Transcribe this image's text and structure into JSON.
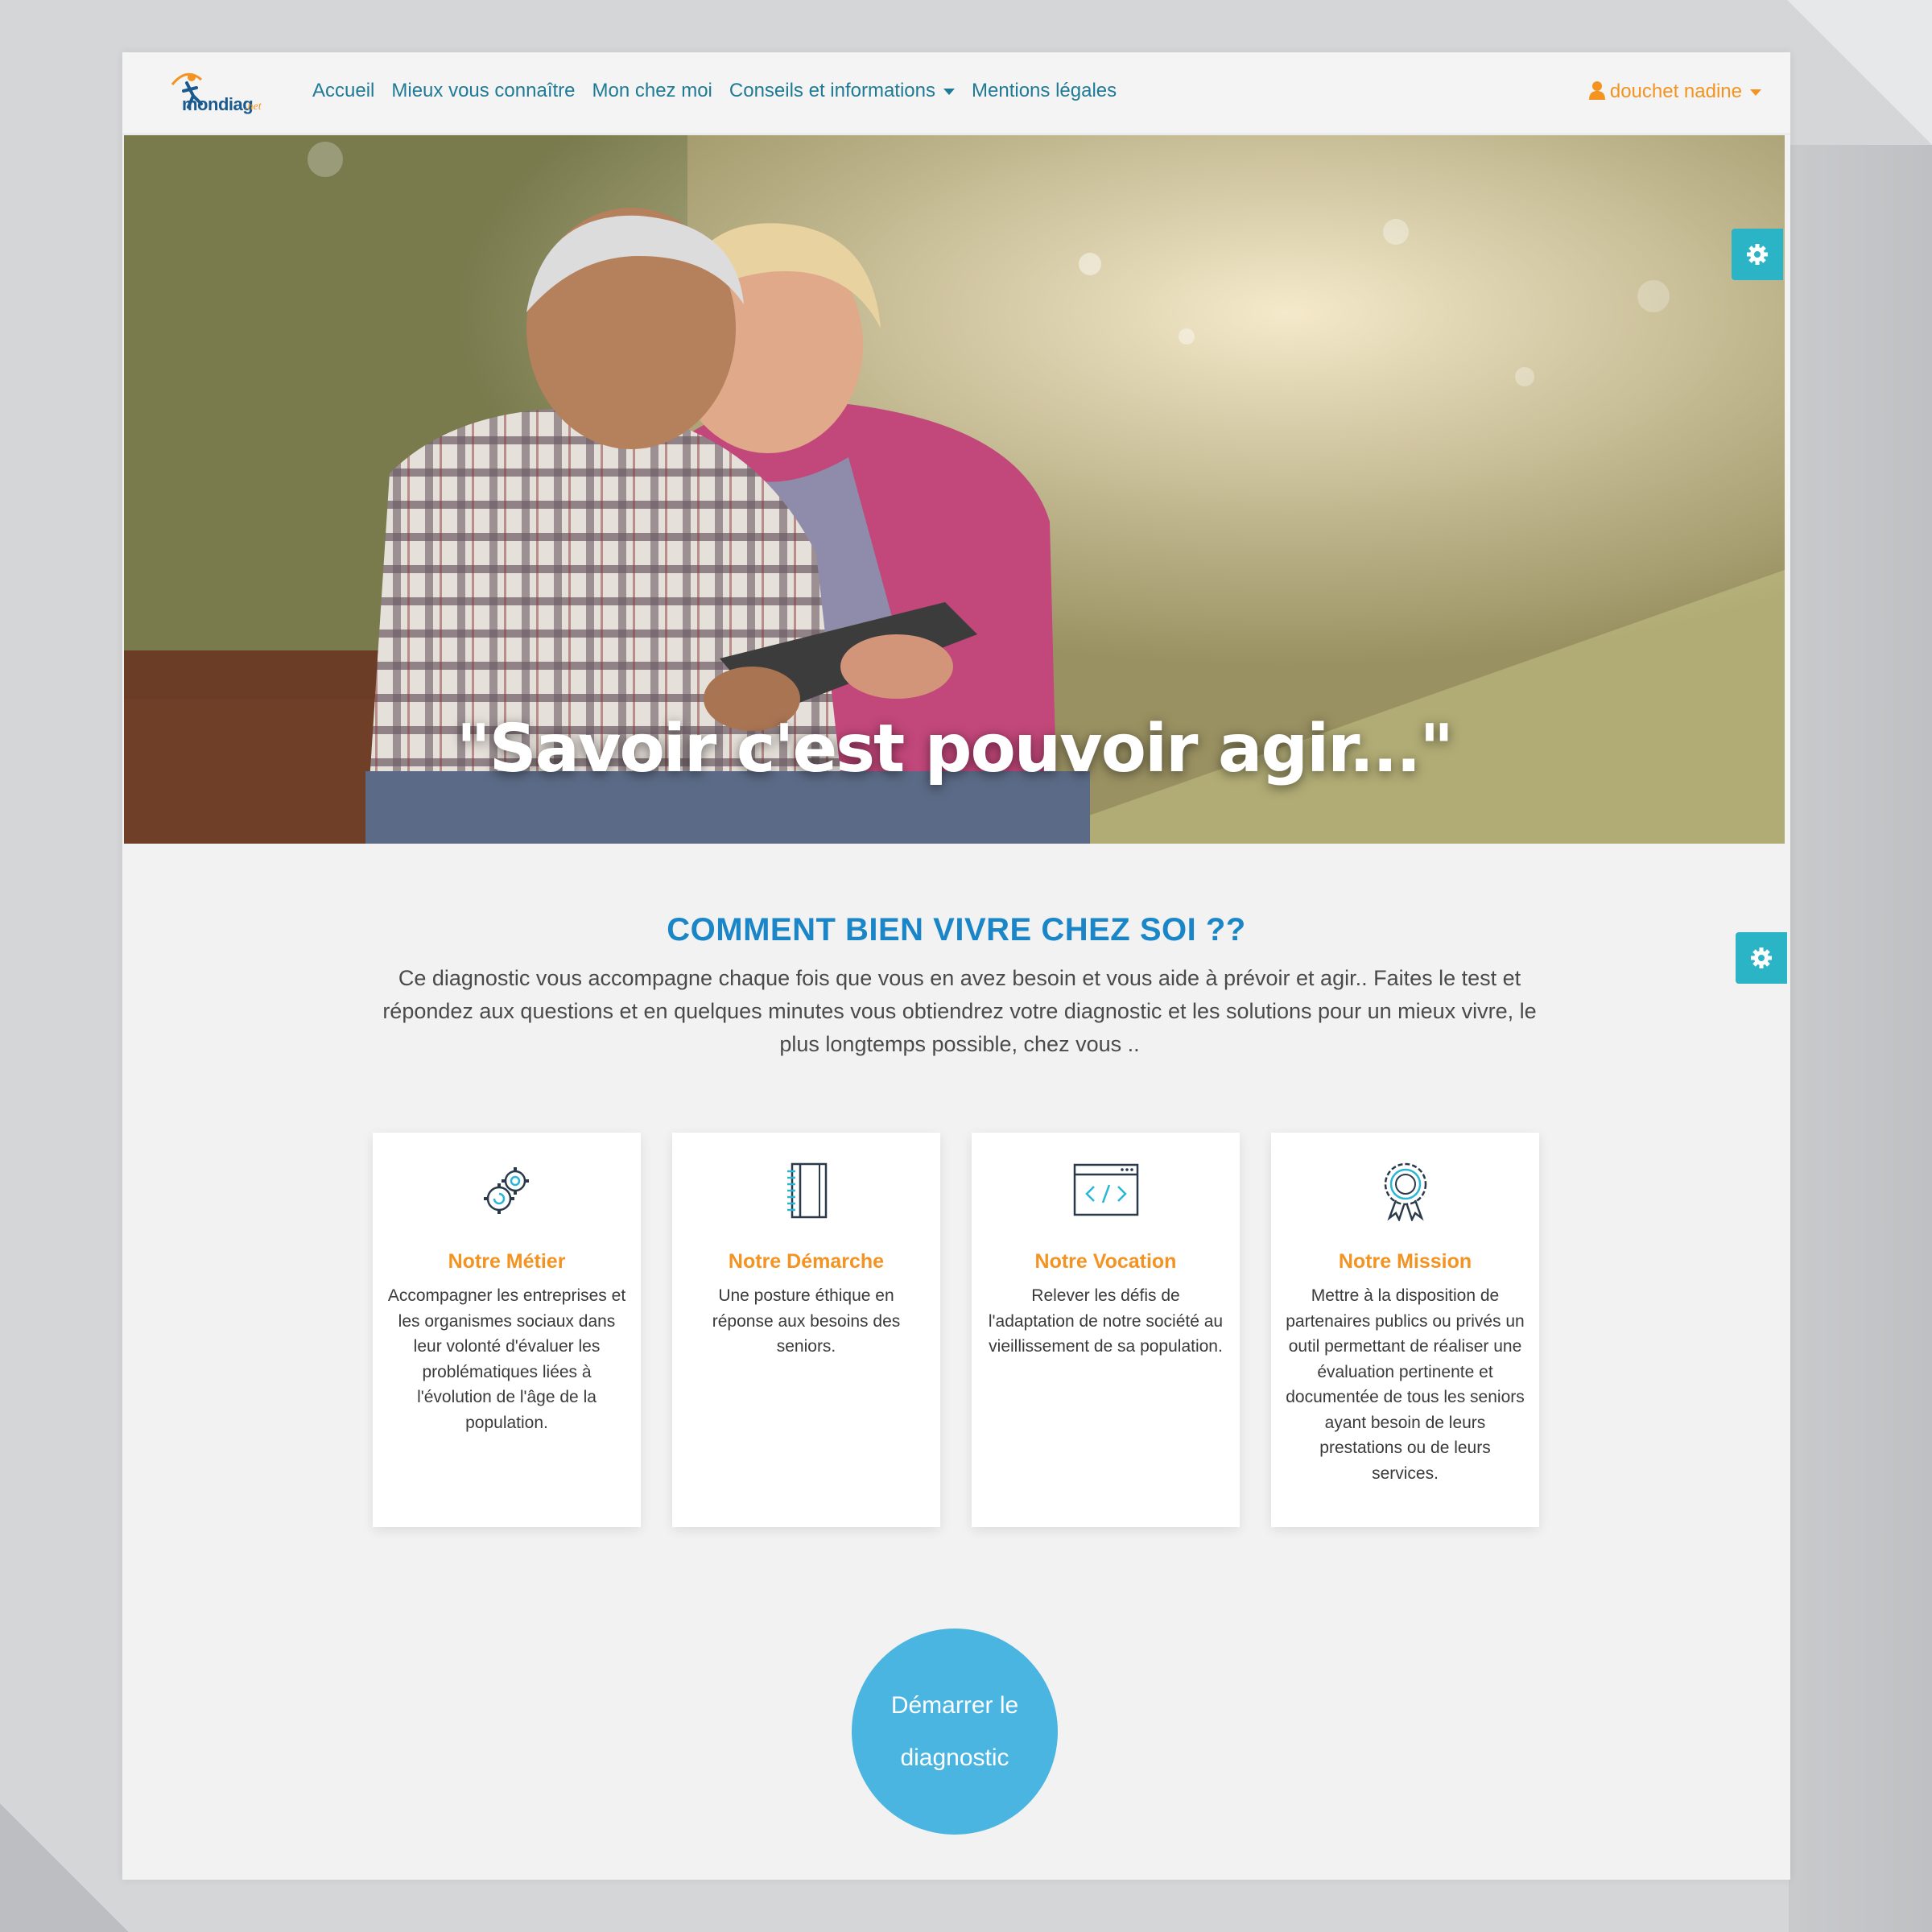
{
  "nav": {
    "logo_text": "mondiag",
    "logo_suffix": ".net",
    "links": [
      "Accueil",
      "Mieux vous connaître",
      "Mon chez moi",
      "Conseils et informations",
      "Mentions légales"
    ],
    "user_name": "douchet nadine"
  },
  "hero": {
    "quote": "\"Savoir c'est pouvoir agir...\""
  },
  "intro": {
    "title": "COMMENT BIEN VIVRE CHEZ SOI ??",
    "text": "Ce diagnostic vous accompagne chaque fois que vous en avez besoin et vous aide à prévoir et agir.. Faites le test et répondez aux questions et en quelques minutes vous obtiendrez votre diagnostic et les solutions pour un mieux vivre, le plus longtemps possible, chez vous .."
  },
  "cards": [
    {
      "icon": "gears-icon",
      "title": "Notre Métier",
      "text": "Accompagner les entreprises et les organismes sociaux dans leur volonté d'évaluer les problématiques liées à l'évolution de l'âge de la population."
    },
    {
      "icon": "notebook-icon",
      "title": "Notre Démarche",
      "text": "Une posture éthique en réponse aux besoins des seniors."
    },
    {
      "icon": "code-window-icon",
      "title": "Notre Vocation",
      "text": "Relever les défis de l'adaptation de notre société au vieillissement de sa population."
    },
    {
      "icon": "award-ribbon-icon",
      "title": "Notre Mission",
      "text": "Mettre à la disposition de partenaires publics ou privés un outil permettant de réaliser une évaluation pertinente et documentée de tous les seniors ayant besoin de leurs prestations ou de leurs services."
    }
  ],
  "cta": {
    "label": "Démarrer le diagnostic"
  },
  "colors": {
    "nav_link": "#1e7a96",
    "accent_orange": "#f39321",
    "title_blue": "#1a86c8",
    "settings_teal": "#2bb3c6",
    "cta_blue": "#4bb5e1"
  }
}
